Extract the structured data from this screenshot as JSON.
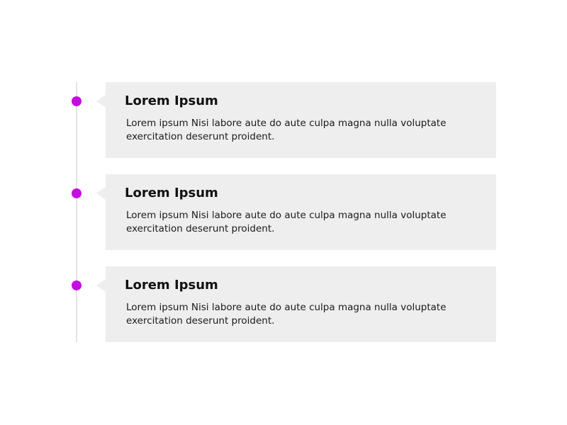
{
  "colors": {
    "accent_dot": "#c20ee0",
    "card_background": "#eeeeee",
    "timeline_line": "#e4e4e4"
  },
  "timeline": {
    "items": [
      {
        "title": "Lorem Ipsum",
        "body": "Lorem ipsum Nisi labore aute do aute culpa magna nulla voluptate exercitation deserunt proident."
      },
      {
        "title": "Lorem Ipsum",
        "body": "Lorem ipsum Nisi labore aute do aute culpa magna nulla voluptate exercitation deserunt proident."
      },
      {
        "title": "Lorem Ipsum",
        "body": "Lorem ipsum Nisi labore aute do aute culpa magna nulla voluptate exercitation deserunt proident."
      }
    ]
  }
}
